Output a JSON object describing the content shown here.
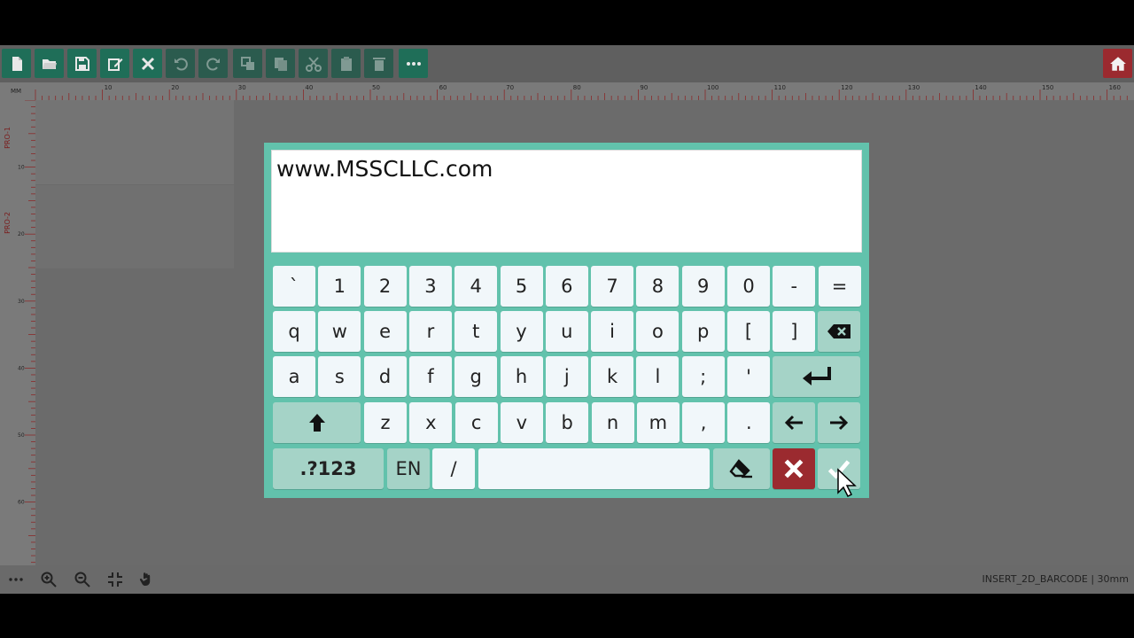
{
  "toolbar": {
    "buttons": [
      {
        "name": "new-file-icon",
        "enabled": true
      },
      {
        "name": "open-folder-icon",
        "enabled": true
      },
      {
        "name": "save-icon",
        "enabled": true
      },
      {
        "name": "edit-icon",
        "enabled": true
      },
      {
        "name": "tools-icon",
        "enabled": true
      },
      {
        "name": "undo-icon",
        "enabled": false
      },
      {
        "name": "redo-icon",
        "enabled": false
      },
      {
        "name": "arrange-icon",
        "enabled": false
      },
      {
        "name": "duplicate-icon",
        "enabled": false
      },
      {
        "name": "cut-icon",
        "enabled": false
      },
      {
        "name": "paste-icon",
        "enabled": false
      },
      {
        "name": "delete-icon",
        "enabled": false
      },
      {
        "name": "more-icon",
        "enabled": true
      }
    ],
    "home_icon": "home-icon"
  },
  "ruler": {
    "unit": "MM",
    "top_labels": [
      "10",
      "20",
      "30",
      "40",
      "50",
      "60",
      "70",
      "80",
      "90",
      "100",
      "110",
      "120",
      "130",
      "140",
      "150",
      "160"
    ],
    "left_labels": [
      "10",
      "20",
      "30",
      "40",
      "50",
      "60"
    ],
    "tracks": [
      "PRO-1",
      "PRO-2"
    ]
  },
  "keyboard": {
    "input_value": "www.MSSCLLC.com",
    "row1": [
      "`",
      "1",
      "2",
      "3",
      "4",
      "5",
      "6",
      "7",
      "8",
      "9",
      "0",
      "-",
      "="
    ],
    "row2": [
      "q",
      "w",
      "e",
      "r",
      "t",
      "y",
      "u",
      "i",
      "o",
      "p",
      "[",
      "]"
    ],
    "row3": [
      "a",
      "s",
      "d",
      "f",
      "g",
      "h",
      "j",
      "k",
      "l",
      ";",
      "'"
    ],
    "row4": [
      "z",
      "x",
      "c",
      "v",
      "b",
      "n",
      "m",
      ",",
      "."
    ],
    "row5": {
      "symbols": ".?123",
      "lang": "EN",
      "slash": "/"
    },
    "icons": {
      "backspace": "backspace-icon",
      "enter": "enter-icon",
      "shift": "shift-up-icon",
      "left": "arrow-left-icon",
      "right": "arrow-right-icon",
      "clear": "eraser-icon",
      "cancel": "close-icon",
      "confirm": "check-icon"
    },
    "colors": {
      "panel": "#62c2ac",
      "key": "#f1f7fa",
      "fn_key": "#a5d3c7",
      "cancel": "#9b2a2f"
    }
  },
  "bottombar": {
    "icons": [
      "more-icon",
      "zoom-in-icon",
      "zoom-out-icon",
      "fit-icon",
      "pan-hand-icon"
    ],
    "status": "INSERT_2D_BARCODE | 30mm"
  }
}
